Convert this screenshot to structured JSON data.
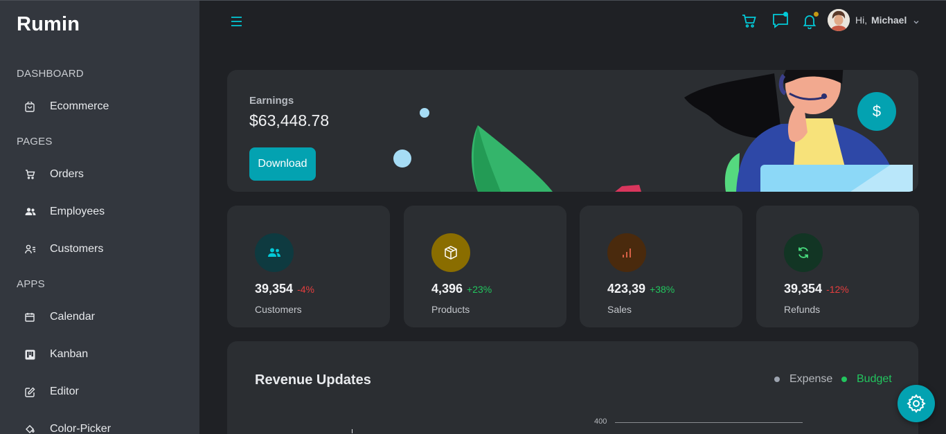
{
  "app": {
    "logo": "Rumin"
  },
  "sidebar": {
    "sections": [
      {
        "title": "DASHBOARD",
        "items": [
          {
            "label": "Ecommerce",
            "icon": "shopping-bag-icon"
          }
        ]
      },
      {
        "title": "PAGES",
        "items": [
          {
            "label": "Orders",
            "icon": "cart-icon"
          },
          {
            "label": "Employees",
            "icon": "users-icon"
          },
          {
            "label": "Customers",
            "icon": "user-list-icon"
          }
        ]
      },
      {
        "title": "APPS",
        "items": [
          {
            "label": "Calendar",
            "icon": "calendar-icon"
          },
          {
            "label": "Kanban",
            "icon": "kanban-icon"
          },
          {
            "label": "Editor",
            "icon": "edit-icon"
          },
          {
            "label": "Color-Picker",
            "icon": "paint-bucket-icon"
          }
        ]
      }
    ]
  },
  "header": {
    "greeting": "Hi,",
    "username": "Michael",
    "icons": [
      "menu-icon",
      "cart-icon",
      "chat-icon",
      "bell-icon",
      "chevron-down-icon"
    ],
    "chat_dot_color": "#03c9d7",
    "bell_dot_color": "#c59a14"
  },
  "earnings": {
    "label": "Earnings",
    "value": "$63,448.78",
    "download_label": "Download",
    "dollar_symbol": "$"
  },
  "stats": [
    {
      "value": "39,354",
      "change": "-4%",
      "change_color": "#e53e3e",
      "label": "Customers",
      "icon": "users-icon",
      "icon_bg": "#0e3a40",
      "icon_color": "#03c9d7"
    },
    {
      "value": "4,396",
      "change": "+23%",
      "change_color": "#22c55e",
      "label": "Products",
      "icon": "box-icon",
      "icon_bg": "#8a6d00",
      "icon_color": "#ffffff"
    },
    {
      "value": "423,39",
      "change": "+38%",
      "change_color": "#22c55e",
      "label": "Sales",
      "icon": "bar-chart-icon",
      "icon_bg": "#4a2a0d",
      "icon_color": "#e8674c"
    },
    {
      "value": "39,354",
      "change": "-12%",
      "change_color": "#e53e3e",
      "label": "Refunds",
      "icon": "refresh-icon",
      "icon_bg": "#123524",
      "icon_color": "#4ade80"
    }
  ],
  "revenue": {
    "title": "Revenue Updates",
    "legend": [
      {
        "label": "Expense",
        "color": "#9ca3af"
      },
      {
        "label": "Budget",
        "color": "#22c55e"
      }
    ],
    "axis_tick": "400"
  },
  "colors": {
    "accent": "#03a2b1"
  }
}
